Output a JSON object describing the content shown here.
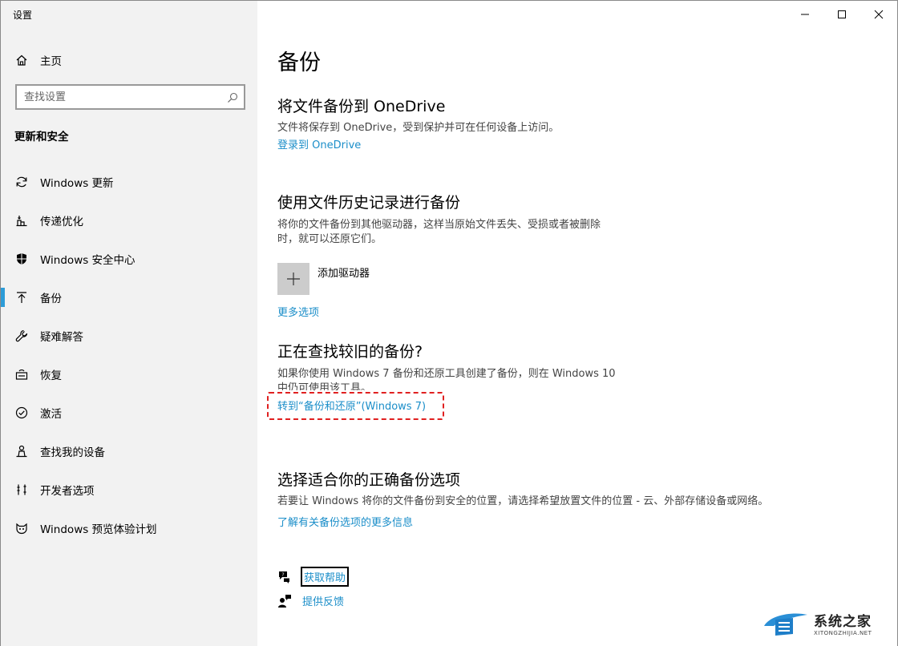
{
  "window": {
    "title": "设置"
  },
  "sidebar": {
    "home_label": "主页",
    "search_placeholder": "查找设置",
    "section_title": "更新和安全",
    "items": [
      {
        "label": "Windows 更新",
        "icon": "refresh-icon",
        "active": false
      },
      {
        "label": "传递优化",
        "icon": "delivery-icon",
        "active": false
      },
      {
        "label": "Windows 安全中心",
        "icon": "shield-icon",
        "active": false
      },
      {
        "label": "备份",
        "icon": "backup-arrow-icon",
        "active": true
      },
      {
        "label": "疑难解答",
        "icon": "wrench-icon",
        "active": false
      },
      {
        "label": "恢复",
        "icon": "recovery-icon",
        "active": false
      },
      {
        "label": "激活",
        "icon": "check-circle-icon",
        "active": false
      },
      {
        "label": "查找我的设备",
        "icon": "person-location-icon",
        "active": false
      },
      {
        "label": "开发者选项",
        "icon": "developer-icon",
        "active": false
      },
      {
        "label": "Windows 预览体验计划",
        "icon": "insider-icon",
        "active": false
      }
    ]
  },
  "main": {
    "page_title": "备份",
    "onedrive": {
      "title": "将文件备份到 OneDrive",
      "desc": "文件将保存到 OneDrive，受到保护并可在任何设备上访问。",
      "link": "登录到 OneDrive"
    },
    "file_history": {
      "title": "使用文件历史记录进行备份",
      "desc_line1": "将你的文件备份到其他驱动器，这样当原始文件丢失、受损或者被删除",
      "desc_line2": "时，就可以还原它们。",
      "add_drive_label": "添加驱动器",
      "more_options": "更多选项"
    },
    "older_backup": {
      "title": "正在查找较旧的备份?",
      "desc_line1": "如果你使用 Windows 7 备份和还原工具创建了备份，则在 Windows 10",
      "desc_line2": "中仍可使用该工具。",
      "link": "转到“备份和还原”(Windows 7)"
    },
    "choose": {
      "title": "选择适合你的正确备份选项",
      "desc": "若要让 Windows 将你的文件备份到安全的位置，请选择希望放置文件的位置 - 云、外部存储设备或网络。",
      "link": "了解有关备份选项的更多信息"
    },
    "help": {
      "get_help": "获取帮助",
      "feedback": "提供反馈"
    }
  },
  "watermark": {
    "name": "系统之家",
    "url": "XITONGZHIJIA.NET"
  },
  "colors": {
    "accent": "#1b8ec9",
    "active_bar": "#2d9cd8",
    "sidebar_bg": "#f2f2f2",
    "highlight": "#e02020"
  }
}
